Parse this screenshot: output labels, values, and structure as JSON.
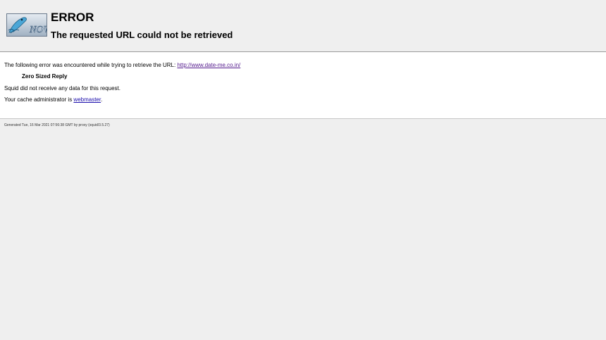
{
  "header": {
    "logo_name": "squid-now-logo",
    "title": "ERROR",
    "subtitle": "The requested URL could not be retrieved"
  },
  "content": {
    "intro_text": "The following error was encountered while trying to retrieve the URL: ",
    "url": "http://www.date-me.co.in/",
    "error_name": "Zero Sized Reply",
    "error_description": "Squid did not receive any data for this request.",
    "admin_prefix": "Your cache administrator is ",
    "admin_link": "webmaster",
    "admin_suffix": "."
  },
  "footer": {
    "generated": "Generated Tue, 16 Mar 2021 07:56:38 GMT by proxy (squid/3.5.27)"
  },
  "colors": {
    "background": "#efefef",
    "content_bg": "#ffffff",
    "link_visited": "#52188c",
    "link": "#1a0dab"
  }
}
